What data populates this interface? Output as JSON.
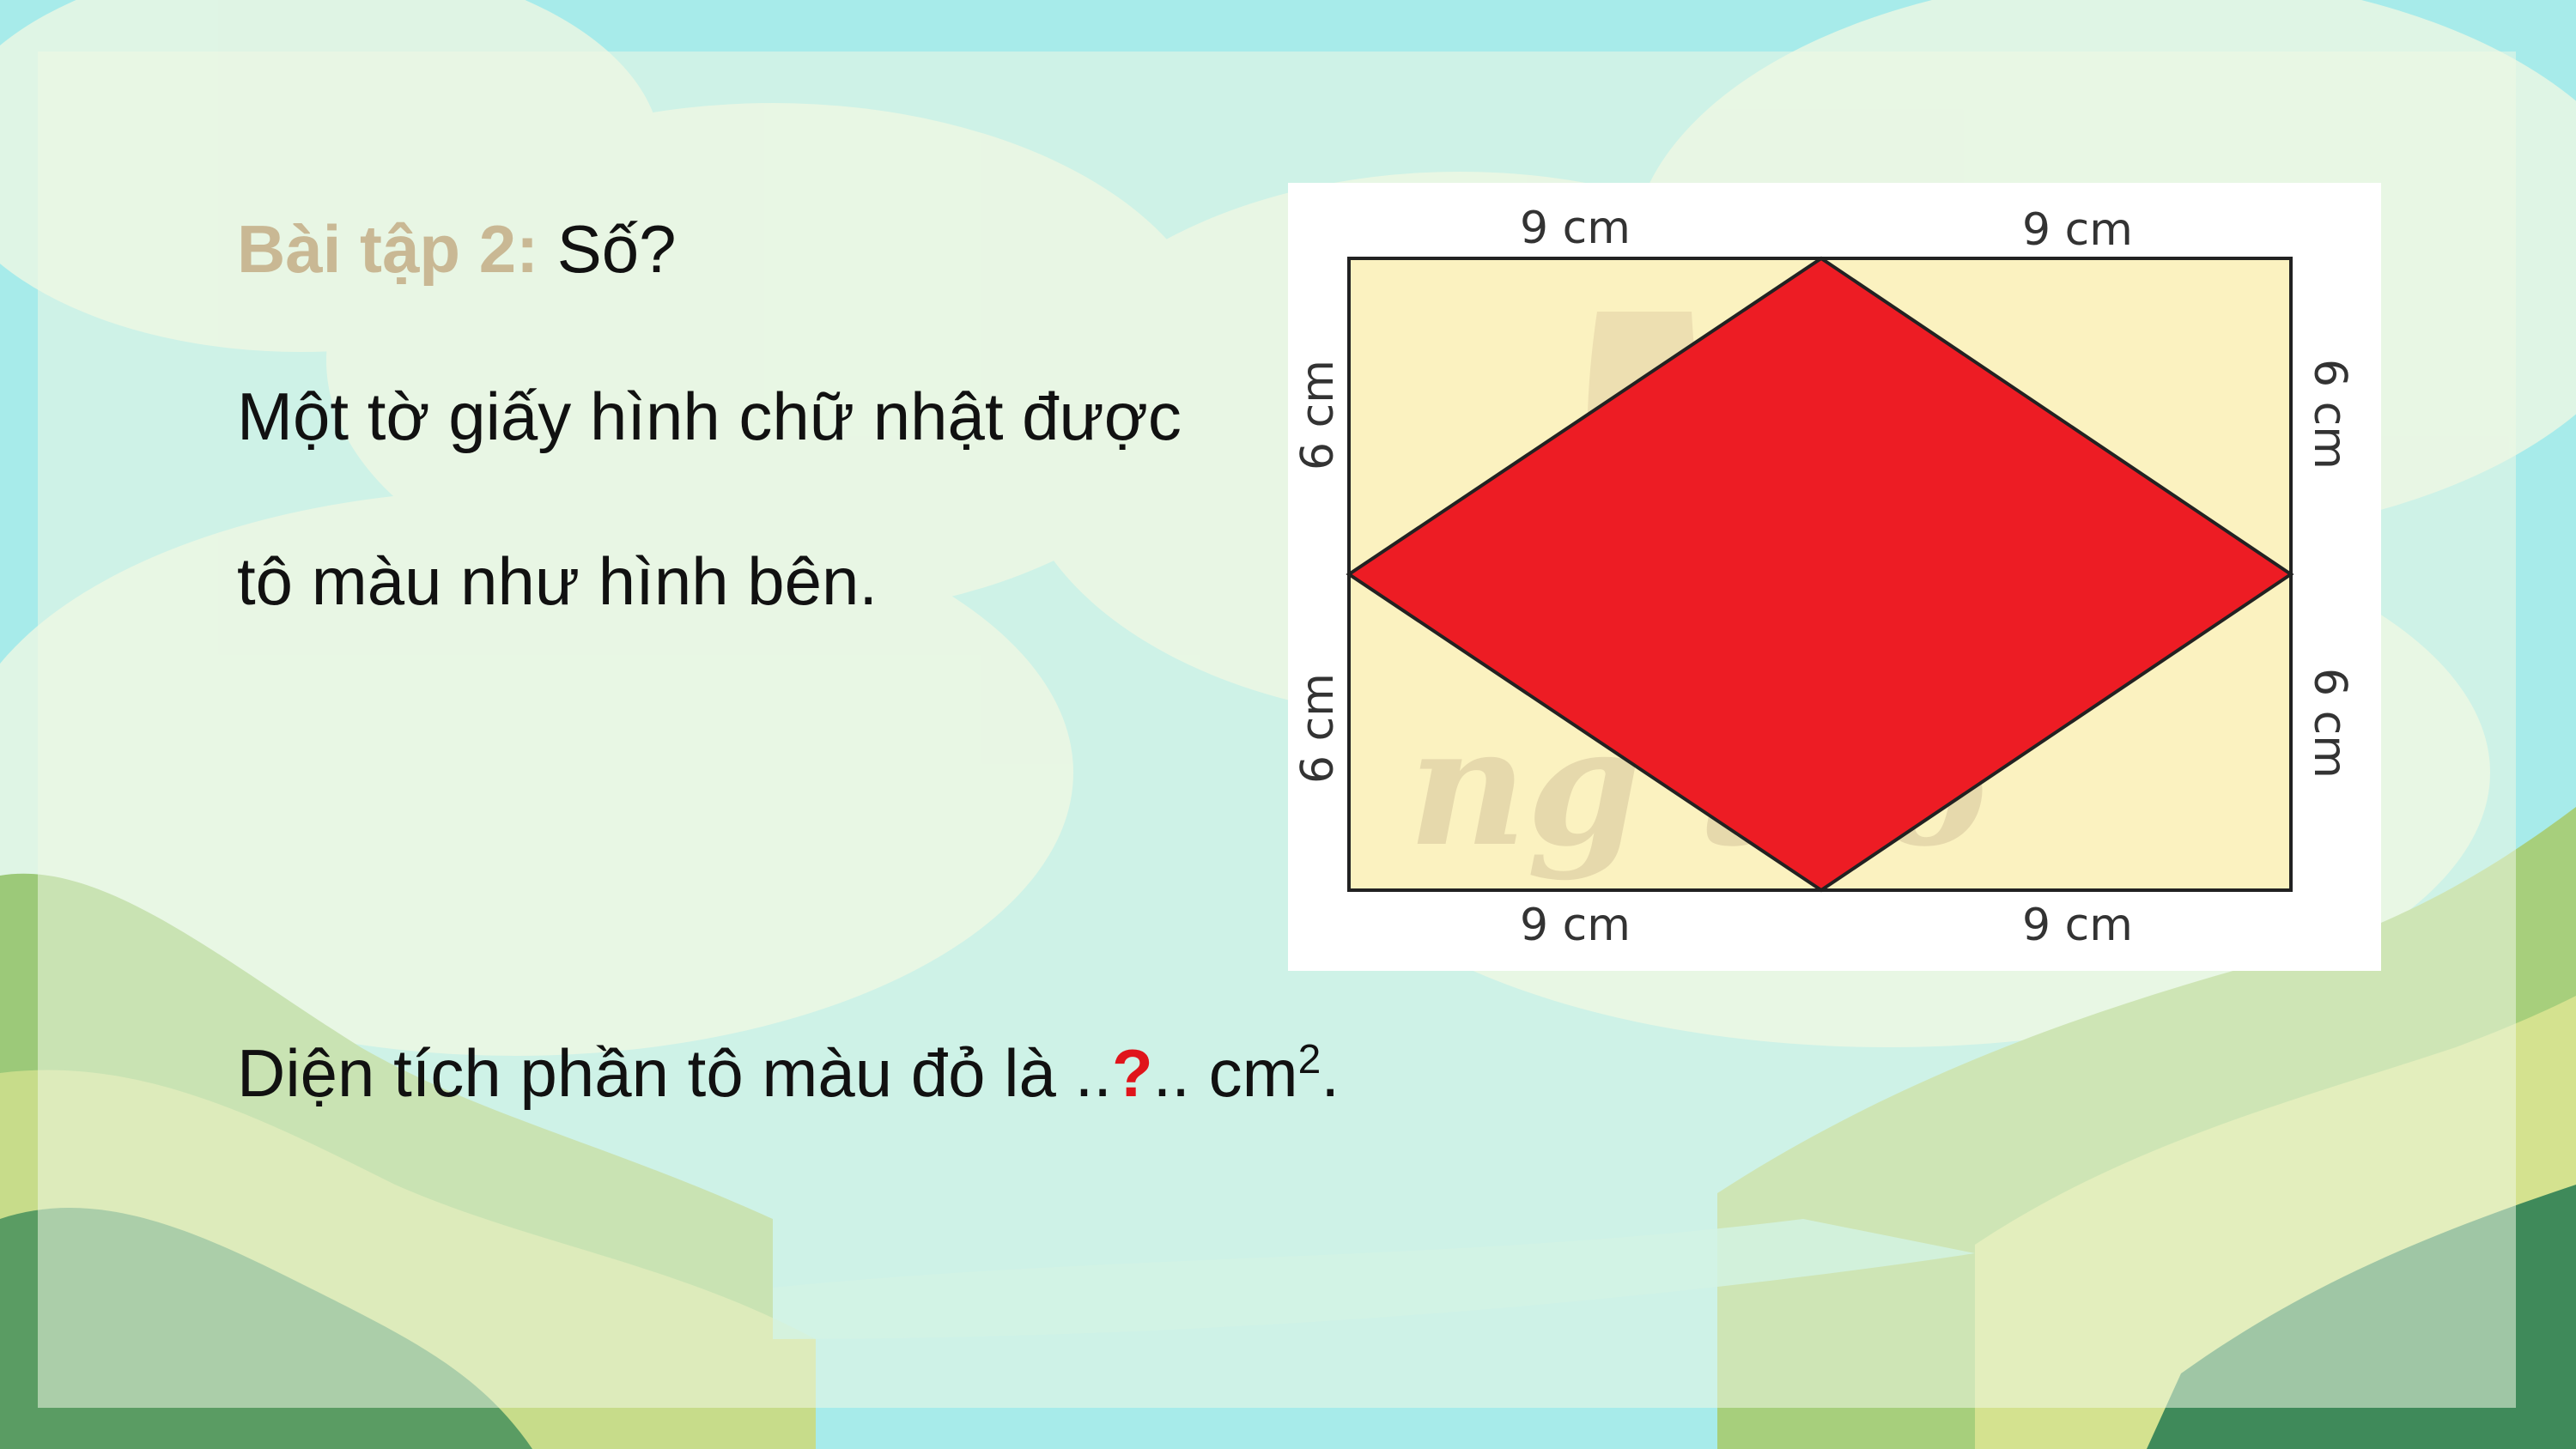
{
  "exercise": {
    "title_label": "Bài tập 2:",
    "title_rest": "Số?",
    "line1": "Một tờ giấy hình chữ nhật được",
    "line2": "tô màu như hình bên.",
    "answer_prefix": "Diện tích phần tô màu đỏ là ..",
    "answer_mark": "?",
    "answer_mid": ".. cm",
    "answer_sup": "2",
    "answer_end": "."
  },
  "figure": {
    "top_left": "9 cm",
    "top_right": "9 cm",
    "bottom_left": "9 cm",
    "bottom_right": "9 cm",
    "left_top": "6 cm",
    "left_bottom": "6 cm",
    "right_top": "6 cm",
    "right_bottom": "6 cm",
    "watermark": "ng tạo"
  },
  "colors": {
    "rhombus": "#ed1c24",
    "rectangle": "#fbf2c0",
    "title_label": "#c9b894",
    "question_mark": "#e0141b"
  }
}
